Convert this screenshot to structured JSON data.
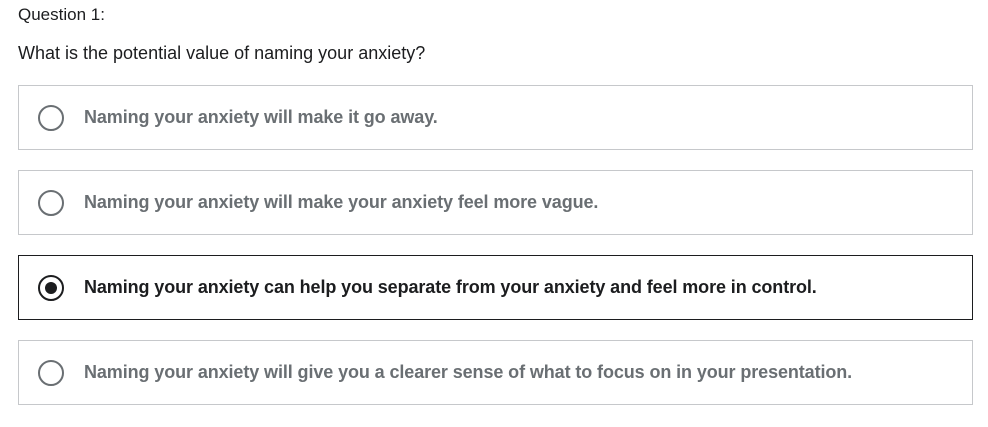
{
  "question": {
    "label": "Question 1:",
    "text": "What is the potential value of naming your anxiety?"
  },
  "options": [
    {
      "text": "Naming your anxiety will make it go away.",
      "selected": false
    },
    {
      "text": "Naming your anxiety will make your anxiety feel more vague.",
      "selected": false
    },
    {
      "text": "Naming your anxiety can help you separate from your anxiety and feel more in control.",
      "selected": true
    },
    {
      "text": "Naming your anxiety will give you a clearer sense of what to focus on in your presentation.",
      "selected": false
    }
  ],
  "colors": {
    "text_primary": "#1c1d1f",
    "text_muted": "#6a6f73",
    "border": "#c6c8cb",
    "border_selected": "#1c1d1f"
  }
}
